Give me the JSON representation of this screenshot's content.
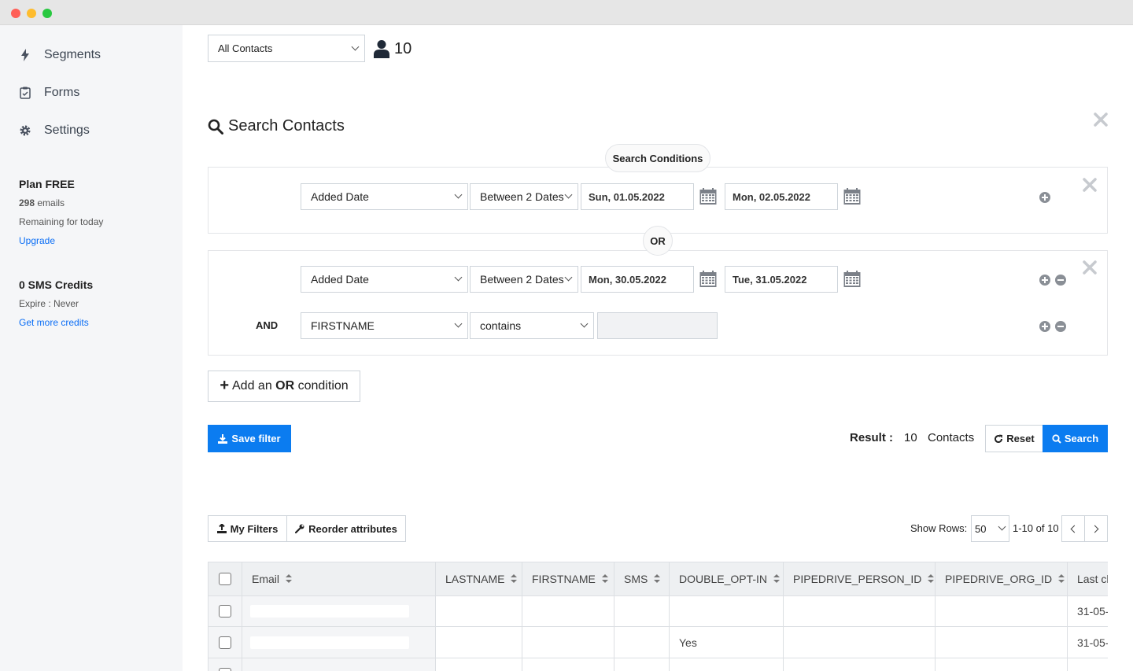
{
  "colors": {
    "accent": "#0b7cf0",
    "close_dot": "#ff5f57",
    "min_dot": "#febc2e",
    "max_dot": "#28c840"
  },
  "sidebar": {
    "items": [
      {
        "label": "Segments",
        "icon": "bolt-icon"
      },
      {
        "label": "Forms",
        "icon": "clipboard-check-icon"
      },
      {
        "label": "Settings",
        "icon": "gear-icon"
      }
    ],
    "plan": {
      "title": "Plan FREE",
      "emails_count": "298",
      "emails_label": "emails",
      "remaining": "Remaining for today",
      "upgrade": "Upgrade"
    },
    "sms": {
      "title": "0 SMS Credits",
      "expire": "Expire : Never",
      "link": "Get more credits"
    }
  },
  "header": {
    "list_select": "All Contacts",
    "contact_count": "10"
  },
  "search": {
    "title": "Search Contacts",
    "conditions_label": "Search Conditions",
    "or_label": "OR",
    "group1": {
      "field": "Added Date",
      "operator": "Between 2 Dates",
      "date_from": "Sun, 01.05.2022",
      "date_to": "Mon, 02.05.2022"
    },
    "group2": {
      "row1": {
        "field": "Added Date",
        "operator": "Between 2 Dates",
        "date_from": "Mon, 30.05.2022",
        "date_to": "Tue, 31.05.2022"
      },
      "row2": {
        "connector": "AND",
        "field": "FIRSTNAME",
        "operator": "contains",
        "value": ""
      }
    },
    "add_or_prefix": "Add an",
    "add_or_bold": "OR",
    "add_or_suffix": "condition",
    "save_filter": "Save filter",
    "result_label": "Result :",
    "result_count": "10",
    "result_unit": "Contacts",
    "reset": "Reset",
    "search_btn": "Search"
  },
  "toolbar": {
    "my_filters": "My Filters",
    "reorder": "Reorder attributes",
    "show_rows_label": "Show Rows:",
    "rows_value": "50",
    "pagination": "1-10 of 10"
  },
  "table": {
    "columns": [
      "Email",
      "LASTNAME",
      "FIRSTNAME",
      "SMS",
      "DOUBLE_OPT-IN",
      "PIPEDRIVE_PERSON_ID",
      "PIPEDRIVE_ORG_ID",
      "Last ch"
    ],
    "rows": [
      {
        "double_opt_in": "",
        "last": "31-05-"
      },
      {
        "double_opt_in": "Yes",
        "last": "31-05-"
      }
    ]
  }
}
